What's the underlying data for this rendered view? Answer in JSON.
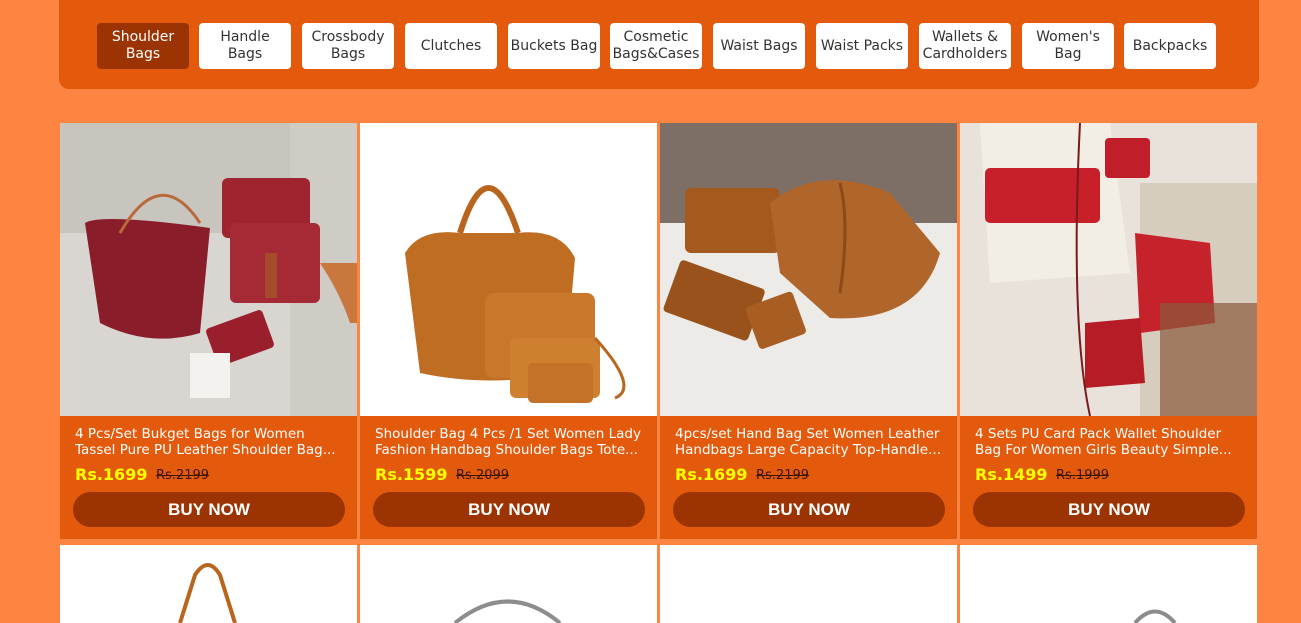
{
  "categories": [
    {
      "label": "Shoulder Bags",
      "active": true
    },
    {
      "label": "Handle Bags",
      "active": false
    },
    {
      "label": "Crossbody Bags",
      "active": false
    },
    {
      "label": "Clutches",
      "active": false
    },
    {
      "label": "Buckets Bag",
      "active": false
    },
    {
      "label": "Cosmetic Bags&Cases",
      "active": false
    },
    {
      "label": "Waist Bags",
      "active": false
    },
    {
      "label": "Waist Packs",
      "active": false
    },
    {
      "label": "Wallets & Cardholders",
      "active": false
    },
    {
      "label": "Women's Bag",
      "active": false
    },
    {
      "label": "Backpacks",
      "active": false
    }
  ],
  "products": [
    {
      "title_line1": "4 Pcs/Set Bukget Bags for Women",
      "title_line2": "Tassel Pure PU Leather Shoulder Bag...",
      "price": "Rs.1699",
      "old_price": "Rs.2199",
      "buy_label": "BUY NOW"
    },
    {
      "title_line1": "Shoulder Bag 4 Pcs /1 Set Women Lady",
      "title_line2": "Fashion Handbag Shoulder Bags Tote...",
      "price": "Rs.1599",
      "old_price": "Rs.2099",
      "buy_label": "BUY NOW"
    },
    {
      "title_line1": "4pcs/set Hand Bag Set Women Leather",
      "title_line2": "Handbags Large Capacity Top-Handle...",
      "price": "Rs.1699",
      "old_price": "Rs.2199",
      "buy_label": "BUY NOW"
    },
    {
      "title_line1": "4 Sets PU Card Pack Wallet Shoulder",
      "title_line2": "Bag For Women Girls Beauty Simple...",
      "price": "Rs.1499",
      "old_price": "Rs.1999",
      "buy_label": "BUY NOW"
    }
  ],
  "colors": {
    "page_bg": "#fe8442",
    "bar_bg": "#e45a0c",
    "accent_dark": "#9b3402",
    "price": "#ffff00"
  }
}
